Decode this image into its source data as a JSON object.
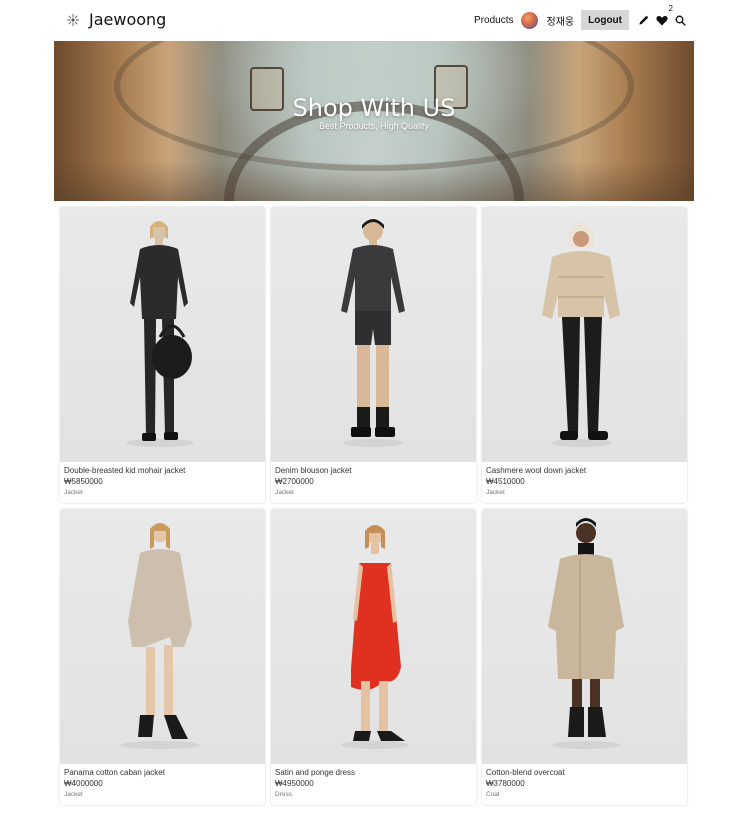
{
  "navbar": {
    "brand": "Jaewoong",
    "products_link": "Products",
    "user_name": "정재웅",
    "logout_label": "Logout",
    "wishlist_count": "2"
  },
  "hero": {
    "title": "Shop With US",
    "subtitle": "Best Products, High Quality"
  },
  "products": [
    {
      "name": "Double-breasted kid mohair jacket",
      "price": "₩5850000",
      "category": "Jacket",
      "outfit": "black-suit-bag"
    },
    {
      "name": "Denim blouson jacket",
      "price": "₩2700000",
      "category": "Jacket",
      "outfit": "black-denim-shorts"
    },
    {
      "name": "Cashmere wool down jacket",
      "price": "₩4510000",
      "category": "Jacket",
      "outfit": "beige-puffer-black-pants"
    },
    {
      "name": "Panama cotton caban jacket",
      "price": "₩4000000",
      "category": "Jacket",
      "outfit": "beige-caban-bare-legs"
    },
    {
      "name": "Satin and ponge dress",
      "price": "₩4950000",
      "category": "Dress",
      "outfit": "red-slip-dress"
    },
    {
      "name": "Cotton-blend overcoat",
      "price": "₩3780000",
      "category": "Coat",
      "outfit": "beige-overcoat"
    }
  ],
  "colors": {
    "logout_bg": "#d7d7d7",
    "card_photo_bg": "#e6e6e6",
    "red_dress": "#e0301f",
    "beige": "#c8b79c"
  }
}
